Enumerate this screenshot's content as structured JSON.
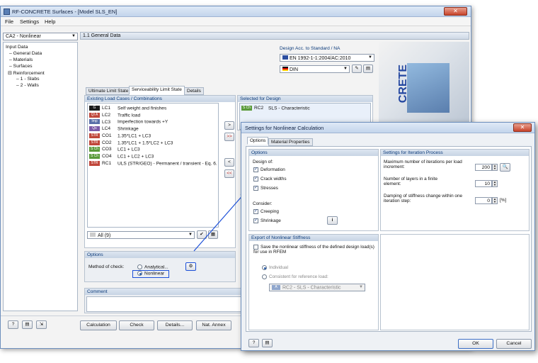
{
  "window": {
    "title": "RF-CONCRETE Surfaces - [Model SLS_EN]",
    "close": "✕"
  },
  "menu": [
    "File",
    "Settings",
    "Help"
  ],
  "case_select": "CA2 - Nonlinear",
  "tree": {
    "root": "Input Data",
    "items": [
      "General Data",
      "Materials",
      "Surfaces",
      "Reinforcement"
    ],
    "sub": [
      "1 - Slabs",
      "2 - Walls"
    ]
  },
  "main": {
    "header": "1.1 General Data",
    "design_label": "Design Acc. to Standard / NA",
    "standard": "EN 1992-1-1:2004/AC:2010",
    "na": "DIN",
    "tabs": [
      "Ultimate Limit State",
      "Serviceability Limit State",
      "Details"
    ],
    "existing_label": "Existing Load Cases / Combinations",
    "selected_label": "Selected for Design",
    "load_rows": [
      {
        "badge": "G",
        "color": "#1a1a1a",
        "id": "LC1",
        "desc": "Self weight and finishes"
      },
      {
        "badge": "QI A",
        "color": "#c0463a",
        "id": "LC2",
        "desc": "Traffic load"
      },
      {
        "badge": "Imp",
        "color": "#5a6fa8",
        "id": "LC3",
        "desc": "Imperfection towards +Y"
      },
      {
        "badge": "Qs",
        "color": "#7c5aa8",
        "id": "LC4",
        "desc": "Shrinkage"
      },
      {
        "badge": "STR",
        "color": "#c0463a",
        "id": "CO1",
        "desc": "1.35*LC1 + LC3"
      },
      {
        "badge": "STR",
        "color": "#c0463a",
        "id": "CO2",
        "desc": "1.35*LC1 + 1.5*LC2 + LC3"
      },
      {
        "badge": "S Ch",
        "color": "#5a9a3a",
        "id": "CO3",
        "desc": "LC1 + LC3"
      },
      {
        "badge": "S Ch",
        "color": "#5a9a3a",
        "id": "CO4",
        "desc": "LC1 + LC2 + LC3"
      },
      {
        "badge": "STR",
        "color": "#c0463a",
        "id": "RC1",
        "desc": "ULS (STR/GEO) - Permanent / transient - Eq. 6."
      }
    ],
    "selected_row": {
      "badge": "S Ch",
      "id": "RC2",
      "desc": "SLS - Characteristic"
    },
    "filter": "All (9)",
    "options_label": "Options",
    "method_label": "Method of check:",
    "analytical": "Analytical...",
    "nonlinear": "Nonlinear",
    "comment_label": "Comment"
  },
  "bottom_buttons": [
    "Calculation",
    "Check",
    "Details...",
    "Nat. Annex"
  ],
  "dialog": {
    "title": "Settings for Nonlinear Calculation",
    "close": "✕",
    "tabs": [
      "Options",
      "Material Properties"
    ],
    "options_header": "Options",
    "design_of": "Design of:",
    "design_items": [
      "Deformation",
      "Crack widths",
      "Stresses"
    ],
    "consider": "Consider:",
    "consider_items": [
      "Creeping",
      "Shrinkage"
    ],
    "iter_header": "Settings for Iteration Process",
    "iter_rows": [
      {
        "label": "Maximum number of iterations per load increment:",
        "value": "200"
      },
      {
        "label": "Number of layers in a finite element:",
        "value": "10"
      },
      {
        "label": "Damping of stiffness change within one iteration step:",
        "value": "0",
        "unit": "[%]"
      }
    ],
    "export_header": "Export of Nonlinear Stiffness",
    "export_check": "Save the nonlinear stiffness of the defined design load(s) for use in RFEM",
    "individual": "Individual",
    "consistent": "Consistent for reference load:",
    "ref_load": "RC2 - SLS - Characteristic",
    "ok": "OK",
    "cancel": "Cancel"
  },
  "banner_text": "CRETE",
  "colors": {
    "accent": "#1b4fd8",
    "title_bg": "#c3d5ec"
  }
}
